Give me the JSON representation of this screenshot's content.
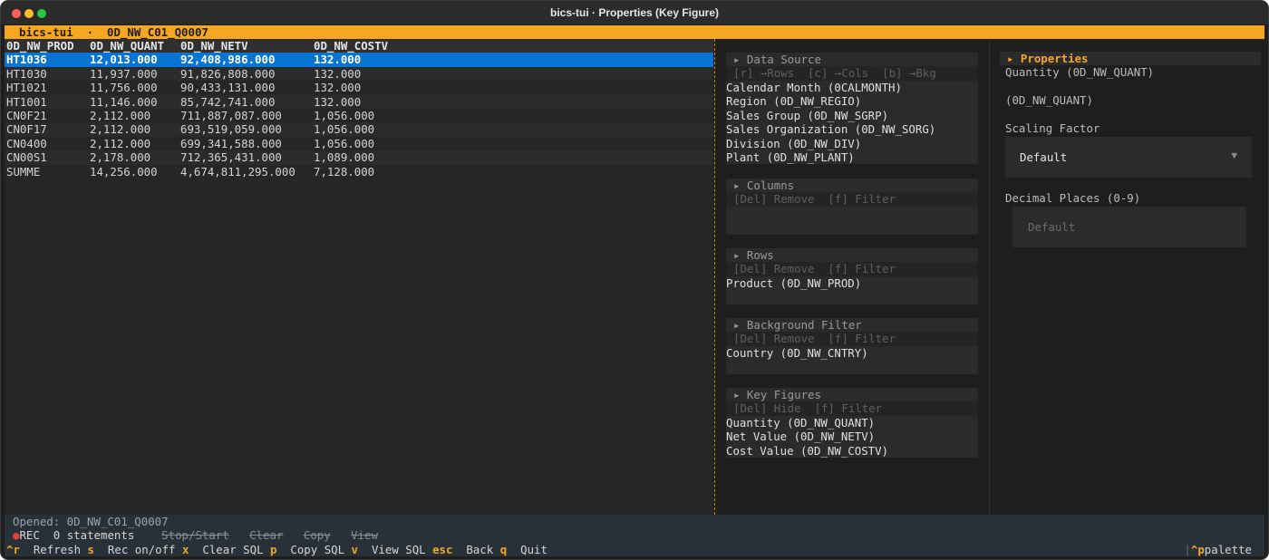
{
  "window": {
    "title": "bics-tui · Properties (Key Figure)"
  },
  "header": {
    "app": "bics-tui",
    "separator": "·",
    "query": "0D_NW_C01_Q0007"
  },
  "table": {
    "columns": [
      "0D_NW_PROD",
      "0D_NW_QUANT",
      "0D_NW_NETV",
      "0D_NW_COSTV"
    ],
    "rows": [
      [
        "HT1036",
        "12,013.000",
        "92,408,986.000",
        "132.000"
      ],
      [
        "HT1030",
        "11,937.000",
        "91,826,808.000",
        "132.000"
      ],
      [
        "HT1021",
        "11,756.000",
        "90,433,131.000",
        "132.000"
      ],
      [
        "HT1001",
        "11,146.000",
        "85,742,741.000",
        "132.000"
      ],
      [
        "CN0F21",
        "2,112.000",
        "711,887,087.000",
        "1,056.000"
      ],
      [
        "CN0F17",
        "2,112.000",
        "693,519,059.000",
        "1,056.000"
      ],
      [
        "CN0400",
        "2,112.000",
        "699,341,588.000",
        "1,056.000"
      ],
      [
        "CN00S1",
        "2,178.000",
        "712,365,431.000",
        "1,089.000"
      ],
      [
        "SUMME",
        "14,256.000",
        "4,674,811,295.000",
        "7,128.000"
      ]
    ],
    "selected_row": 0
  },
  "sections": {
    "data_source": {
      "title": "▸ Data Source",
      "hint": "[r] →Rows  [c] →Cols  [b] →Bkg",
      "items": [
        "Calendar Month (0CALMONTH)",
        "Region (0D_NW_REGIO)",
        "Sales Group (0D_NW_SGRP)",
        "Sales Organization (0D_NW_SORG)",
        "Division (0D_NW_DIV)",
        "Plant (0D_NW_PLANT)"
      ]
    },
    "columns": {
      "title": "▸ Columns",
      "hint": "[Del] Remove  [f] Filter",
      "items": []
    },
    "rows": {
      "title": "▸ Rows",
      "hint": "[Del] Remove  [f] Filter",
      "items": [
        "Product (0D_NW_PROD)"
      ]
    },
    "background_filter": {
      "title": "▸ Background Filter",
      "hint": "[Del] Remove  [f] Filter",
      "items": [
        "Country (0D_NW_CNTRY)"
      ]
    },
    "key_figures": {
      "title": "▸ Key Figures",
      "hint": "[Del] Hide  [f] Filter",
      "items": [
        "Quantity (0D_NW_QUANT)",
        "Net Value (0D_NW_NETV)",
        "Cost Value (0D_NW_COSTV)"
      ]
    }
  },
  "properties": {
    "title": "▸ Properties",
    "name": "Quantity (0D_NW_QUANT)",
    "technical_name": "(0D_NW_QUANT)",
    "scaling_label": "Scaling Factor",
    "scaling_value": "Default",
    "decimal_label": "Decimal Places (0-9)",
    "decimal_placeholder": "Default"
  },
  "status": {
    "opened": "Opened: 0D_NW_C01_Q0007",
    "rec_dot": "●",
    "rec": "REC",
    "statements": "0 statements",
    "stop_start": "Stop/Start",
    "clear": "Clear",
    "copy": "Copy",
    "view": "View"
  },
  "footer": {
    "keys": [
      {
        "key": "^r",
        "label": "Refresh"
      },
      {
        "key": "s",
        "label": "Rec on/off"
      },
      {
        "key": "x",
        "label": "Clear SQL"
      },
      {
        "key": "p",
        "label": "Copy SQL"
      },
      {
        "key": "v",
        "label": "View SQL"
      },
      {
        "key": "esc",
        "label": "Back"
      },
      {
        "key": "q",
        "label": "Quit"
      }
    ],
    "palette_sep": "|",
    "palette_key": "^p",
    "palette_label": "palette"
  },
  "colors": {
    "accent": "#f5a623",
    "selection": "#0a74d2",
    "status_bg": "#283038",
    "rec": "#e0413a"
  }
}
